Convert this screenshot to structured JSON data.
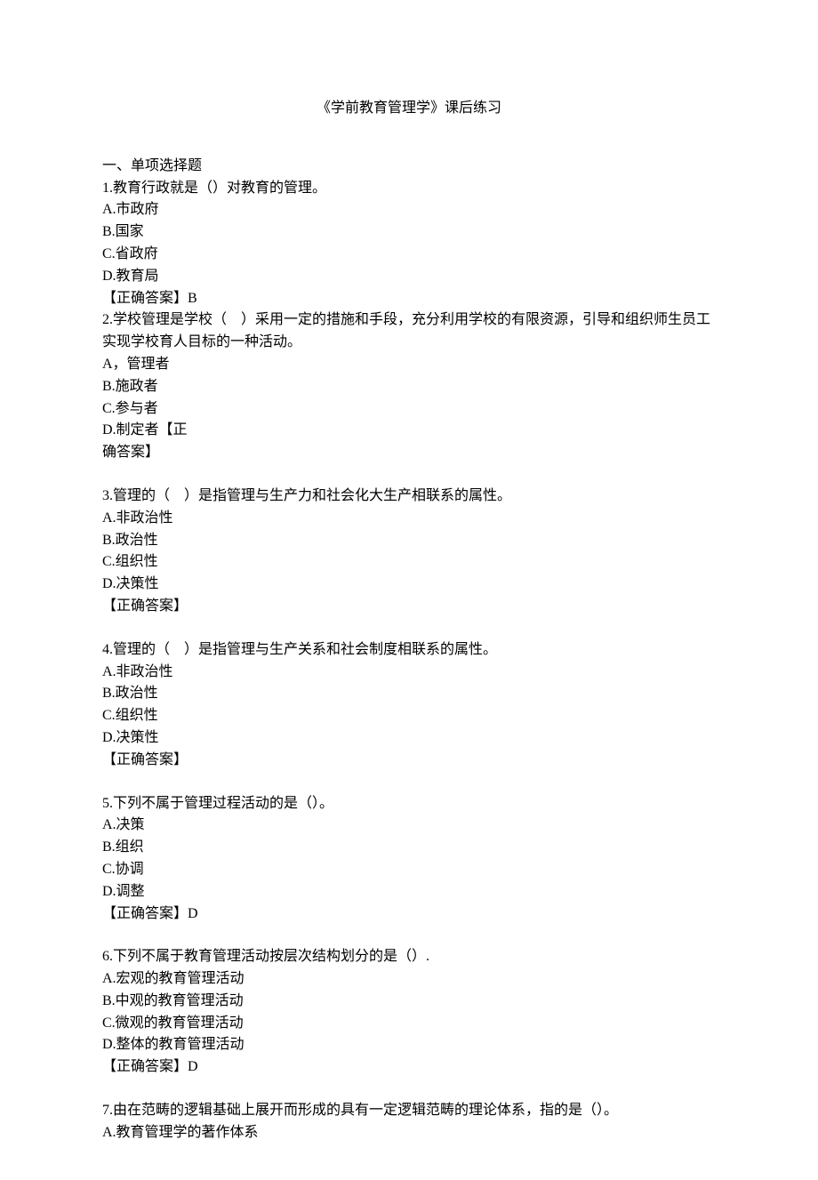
{
  "title": "《学前教育管理学》课后练习",
  "section_heading": "一、单项选择题",
  "questions": [
    {
      "stem": "1.教育行政就是（）对教育的管理。",
      "options": [
        "A.市政府",
        "B.国家",
        "C.省政府",
        "D.教育局"
      ],
      "answer": "【正确答案】B"
    },
    {
      "stem": "2.学校管理是学校（　）采用一定的措施和手段，充分利用学校的有限资源，引导和组织师生员工实现学校育人目标的一种活动。",
      "options": [
        " A，管理者",
        "B.施政者",
        "C.参与者",
        "D.制定者【正",
        "确答案】"
      ],
      "answer": ""
    },
    {
      "stem": "3.管理的（　）是指管理与生产力和社会化大生产相联系的属性。",
      "options": [
        "A.非政治性",
        "B.政治性",
        "C.组织性",
        "D.决策性"
      ],
      "answer": "【正确答案】"
    },
    {
      "stem": "4.管理的（　）是指管理与生产关系和社会制度相联系的属性。",
      "options": [
        "A.非政治性",
        "B.政治性",
        "C.组织性",
        "D.决策性"
      ],
      "answer": "【正确答案】"
    },
    {
      "stem": "5.下列不属于管理过程活动的是（）。",
      "options": [
        "A.决策",
        "B.组织",
        "C.协调",
        "D.调整"
      ],
      "answer": "【正确答案】D"
    },
    {
      "stem": "6.下列不属于教育管理活动按层次结构划分的是（）.",
      "options": [
        "A.宏观的教育管理活动",
        "B.中观的教育管理活动",
        "C.微观的教育管理活动",
        "D.整体的教育管理活动"
      ],
      "answer": "【正确答案】D"
    },
    {
      "stem": "7.由在范畴的逻辑基础上展开而形成的具有一定逻辑范畴的理论体系，指的是（）。",
      "options": [
        "A.教育管理学的著作体系"
      ],
      "answer": ""
    }
  ]
}
